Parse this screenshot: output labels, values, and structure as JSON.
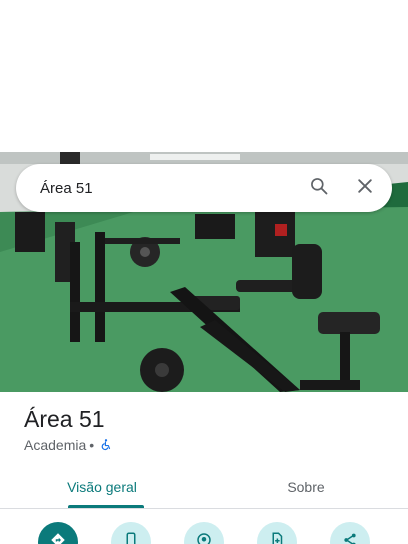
{
  "search": {
    "query": "Área 51"
  },
  "place": {
    "title": "Área 51",
    "category": "Academia",
    "separator": "•"
  },
  "tabs": [
    {
      "label": "Visão geral",
      "active": true
    },
    {
      "label": "Sobre",
      "active": false
    }
  ],
  "actions": [
    {
      "icon": "directions-icon"
    },
    {
      "icon": "phone-icon"
    },
    {
      "icon": "location-icon"
    },
    {
      "icon": "save-icon"
    },
    {
      "icon": "share-icon"
    }
  ],
  "colors": {
    "accent": "#0b7a7b",
    "accent_light": "#cdeef0",
    "gym_floor": "#3f8f57",
    "wheelchair_blue": "#1a73e8"
  }
}
